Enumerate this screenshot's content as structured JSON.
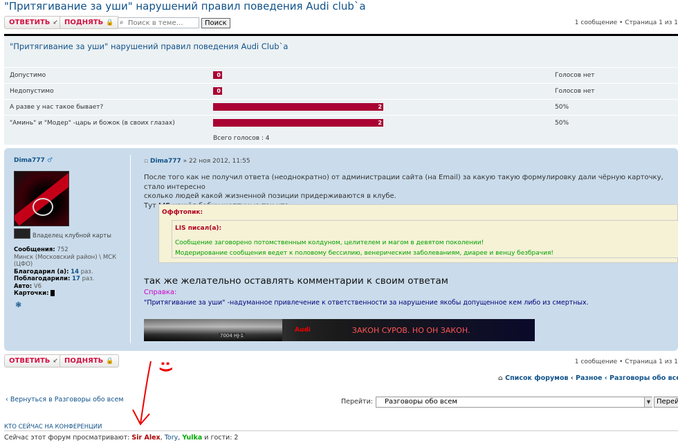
{
  "topic_title": "\"Притягивание за уши\" нарушений правил поведения Audi club`a",
  "toolbar": {
    "reply_label": "ОТВЕТИТЬ",
    "bump_label": "ПОДНЯТЬ",
    "search_placeholder": "Поиск в теме…",
    "search_button": "Поиск",
    "pagination": "1 сообщение • Страница 1 из 1"
  },
  "poll": {
    "title": "\"Притягивание за уши\" нарушений правил поведения Audi Club`a",
    "options": [
      {
        "label": "Допустимо",
        "votes": "0",
        "result": "Голосов нет",
        "fraction": 0
      },
      {
        "label": "Недопустимо",
        "votes": "0",
        "result": "Голосов нет",
        "fraction": 0
      },
      {
        "label": "А разве у нас такое бывает?",
        "votes": "2",
        "result": "50%",
        "fraction": 0.5
      },
      {
        "label": "\"Аминь\" и \"Модер\" -царь и божок (в своих глазах)",
        "votes": "2",
        "result": "50%",
        "fraction": 0.5
      }
    ],
    "total": "Всего голосов : 4"
  },
  "post": {
    "author": "Dima777",
    "author_icon": "male-icon",
    "rank": "Владелец клубной карты",
    "stats": {
      "messages_label": "Сообщения:",
      "messages": "752",
      "location": "Минск (Московский район) \\ МСК (ЦФО)",
      "thanked_label": "Благодарил (а):",
      "thanked": "14",
      "thanked_unit": "раз.",
      "got_thanks_label": "Поблагодарили:",
      "got_thanks": "17",
      "got_thanks_unit": "раз.",
      "car_label": "Авто:",
      "car": "V6",
      "cards_label": "Карточки:"
    },
    "header_author": "Dima777",
    "header_date": "» 22 ноя 2012, 11:55",
    "text_line1": "После того как не получил ответа (неоднократно) от администрации сайта (на Email) за какую такую формулировку дали чёрную карточку, стало интересно",
    "text_line2": "сколько людей какой жизненной позиции придерживаются в клубе.",
    "text_line3_pre": "Тут",
    "text_line3_name": "LIS",
    "text_line3_post": "нашёл бабку шептунью так что",
    "offtopic_title": "Оффтопик:",
    "quote_author": "LIS писал(а):",
    "quote_line1": "Сообщение заговорено потомственным колдуном, целителем и магом в девятом поколении!",
    "quote_line2": "Модерирование сообщения ведет к половому бессилию, венерическим заболеваниям, диарее и венцу безбрачия!",
    "big_text": "так же желательно оставлять комментарии к своим ответам",
    "ref_label": "Справка:",
    "ref_text": "\"Притягивание за уши\" -надуманное привлечение к ответственности за нарушение якобы допущенное кем либо из смертных.",
    "banner_brand": "Audi",
    "banner_plate": "7004 HJ-1",
    "banner_slogan": "ЗАКОН СУРОВ. НО ОН ЗАКОН."
  },
  "nav": {
    "home": "Список форумов",
    "crumb1": "Разное",
    "crumb2": "Разговоры обо всем",
    "back": "Вернуться в Разговоры обо всем",
    "jump_label": "Перейти:",
    "jump_value": "Разговоры обо всем",
    "jump_button": "Перейти"
  },
  "online": {
    "heading": "Кто сейчас на конференции",
    "prefix": "Сейчас этот форум просматривают:",
    "user1": "Sir Alex",
    "user2": "Tory",
    "user3": "Yulka",
    "suffix": "и гости: 2"
  },
  "colors": {
    "accent": "#105289",
    "bar": "#aa0033",
    "post_bg": "#cadceb",
    "poll_bg": "#ecf1f3"
  }
}
